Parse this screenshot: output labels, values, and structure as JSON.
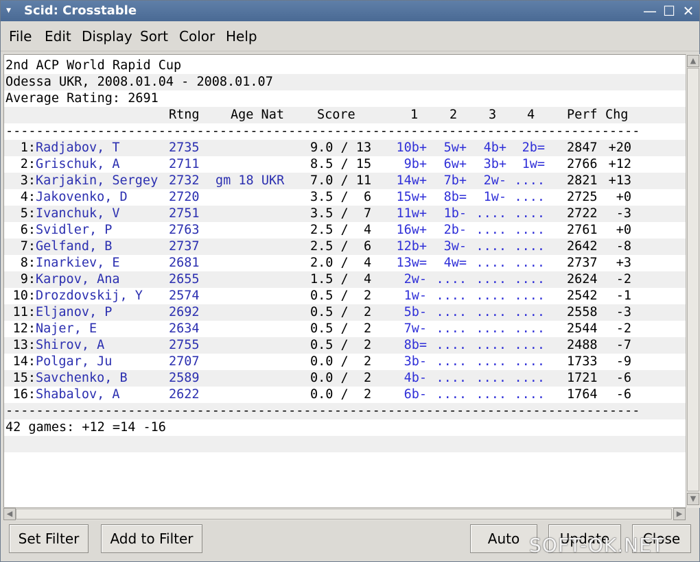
{
  "window": {
    "title": "Scid: Crosstable",
    "menu_arrow": "▾",
    "minimize": "—",
    "maximize": "☐",
    "close": "✕"
  },
  "menubar": [
    "File",
    "Edit",
    "Display",
    "Sort",
    "Color",
    "Help"
  ],
  "header": {
    "event": "2nd ACP World Rapid Cup",
    "site": "Odessa UKR, 2008.01.04 - 2008.01.07",
    "avg": "Average Rating: 2691",
    "col_rtng": "Rtng",
    "col_agenat": "Age Nat",
    "col_score": "Score",
    "col_r1": "1",
    "col_r2": "2",
    "col_r3": "3",
    "col_r4": "4",
    "col_perf": "Perf",
    "col_chg": "Chg"
  },
  "separator": "-----------------------------------------------------------------------------------",
  "players": [
    {
      "num": " 1:",
      "name": "Radjabov, T",
      "rtng": "2735",
      "info": "",
      "score": "9.0 / 13",
      "r1": "10b+",
      "r2": "5w+",
      "r3": "4b+",
      "r4": "2b=",
      "perf": "2847",
      "chg": "+20"
    },
    {
      "num": " 2:",
      "name": "Grischuk, A",
      "rtng": "2711",
      "info": "",
      "score": "8.5 / 15",
      "r1": "9b+",
      "r2": "6w+",
      "r3": "3b+",
      "r4": "1w=",
      "perf": "2766",
      "chg": "+12"
    },
    {
      "num": " 3:",
      "name": "Karjakin, Sergey",
      "rtng": "2732",
      "info": "gm 18 UKR",
      "score": "7.0 / 11",
      "r1": "14w+",
      "r2": "7b+",
      "r3": "2w-",
      "r4": "....",
      "perf": "2821",
      "chg": "+13"
    },
    {
      "num": " 4:",
      "name": "Jakovenko, D",
      "rtng": "2720",
      "info": "",
      "score": "3.5 /  6",
      "r1": "15w+",
      "r2": "8b=",
      "r3": "1w-",
      "r4": "....",
      "perf": "2725",
      "chg": "+0"
    },
    {
      "num": " 5:",
      "name": "Ivanchuk, V",
      "rtng": "2751",
      "info": "",
      "score": "3.5 /  7",
      "r1": "11w+",
      "r2": "1b-",
      "r3": "....",
      "r4": "....",
      "perf": "2722",
      "chg": "-3"
    },
    {
      "num": " 6:",
      "name": "Svidler, P",
      "rtng": "2763",
      "info": "",
      "score": "2.5 /  4",
      "r1": "16w+",
      "r2": "2b-",
      "r3": "....",
      "r4": "....",
      "perf": "2761",
      "chg": "+0"
    },
    {
      "num": " 7:",
      "name": "Gelfand, B",
      "rtng": "2737",
      "info": "",
      "score": "2.5 /  6",
      "r1": "12b+",
      "r2": "3w-",
      "r3": "....",
      "r4": "....",
      "perf": "2642",
      "chg": "-8"
    },
    {
      "num": " 8:",
      "name": "Inarkiev, E",
      "rtng": "2681",
      "info": "",
      "score": "2.0 /  4",
      "r1": "13w=",
      "r2": "4w=",
      "r3": "....",
      "r4": "....",
      "perf": "2737",
      "chg": "+3"
    },
    {
      "num": " 9:",
      "name": "Karpov, Ana",
      "rtng": "2655",
      "info": "",
      "score": "1.5 /  4",
      "r1": "2w-",
      "r2": "....",
      "r3": "....",
      "r4": "....",
      "perf": "2624",
      "chg": "-2"
    },
    {
      "num": "10:",
      "name": "Drozdovskij, Y",
      "rtng": "2574",
      "info": "",
      "score": "0.5 /  2",
      "r1": "1w-",
      "r2": "....",
      "r3": "....",
      "r4": "....",
      "perf": "2542",
      "chg": "-1"
    },
    {
      "num": "11:",
      "name": "Eljanov, P",
      "rtng": "2692",
      "info": "",
      "score": "0.5 /  2",
      "r1": "5b-",
      "r2": "....",
      "r3": "....",
      "r4": "....",
      "perf": "2558",
      "chg": "-3"
    },
    {
      "num": "12:",
      "name": "Najer, E",
      "rtng": "2634",
      "info": "",
      "score": "0.5 /  2",
      "r1": "7w-",
      "r2": "....",
      "r3": "....",
      "r4": "....",
      "perf": "2544",
      "chg": "-2"
    },
    {
      "num": "13:",
      "name": "Shirov, A",
      "rtng": "2755",
      "info": "",
      "score": "0.5 /  2",
      "r1": "8b=",
      "r2": "....",
      "r3": "....",
      "r4": "....",
      "perf": "2488",
      "chg": "-7"
    },
    {
      "num": "14:",
      "name": "Polgar, Ju",
      "rtng": "2707",
      "info": "",
      "score": "0.0 /  2",
      "r1": "3b-",
      "r2": "....",
      "r3": "....",
      "r4": "....",
      "perf": "1733",
      "chg": "-9"
    },
    {
      "num": "15:",
      "name": "Savchenko, B",
      "rtng": "2589",
      "info": "",
      "score": "0.0 /  2",
      "r1": "4b-",
      "r2": "....",
      "r3": "....",
      "r4": "....",
      "perf": "1721",
      "chg": "-6"
    },
    {
      "num": "16:",
      "name": "Shabalov, A",
      "rtng": "2622",
      "info": "",
      "score": "0.0 /  2",
      "r1": "6b-",
      "r2": "....",
      "r3": "....",
      "r4": "....",
      "perf": "1764",
      "chg": "-6"
    }
  ],
  "footer": "42 games: +12 =14 -16",
  "buttons": {
    "set_filter": "Set Filter",
    "add_filter": "Add to Filter",
    "auto": "Auto",
    "update": "Update",
    "close": "Close"
  },
  "watermark": "SOFT-OK.NET"
}
